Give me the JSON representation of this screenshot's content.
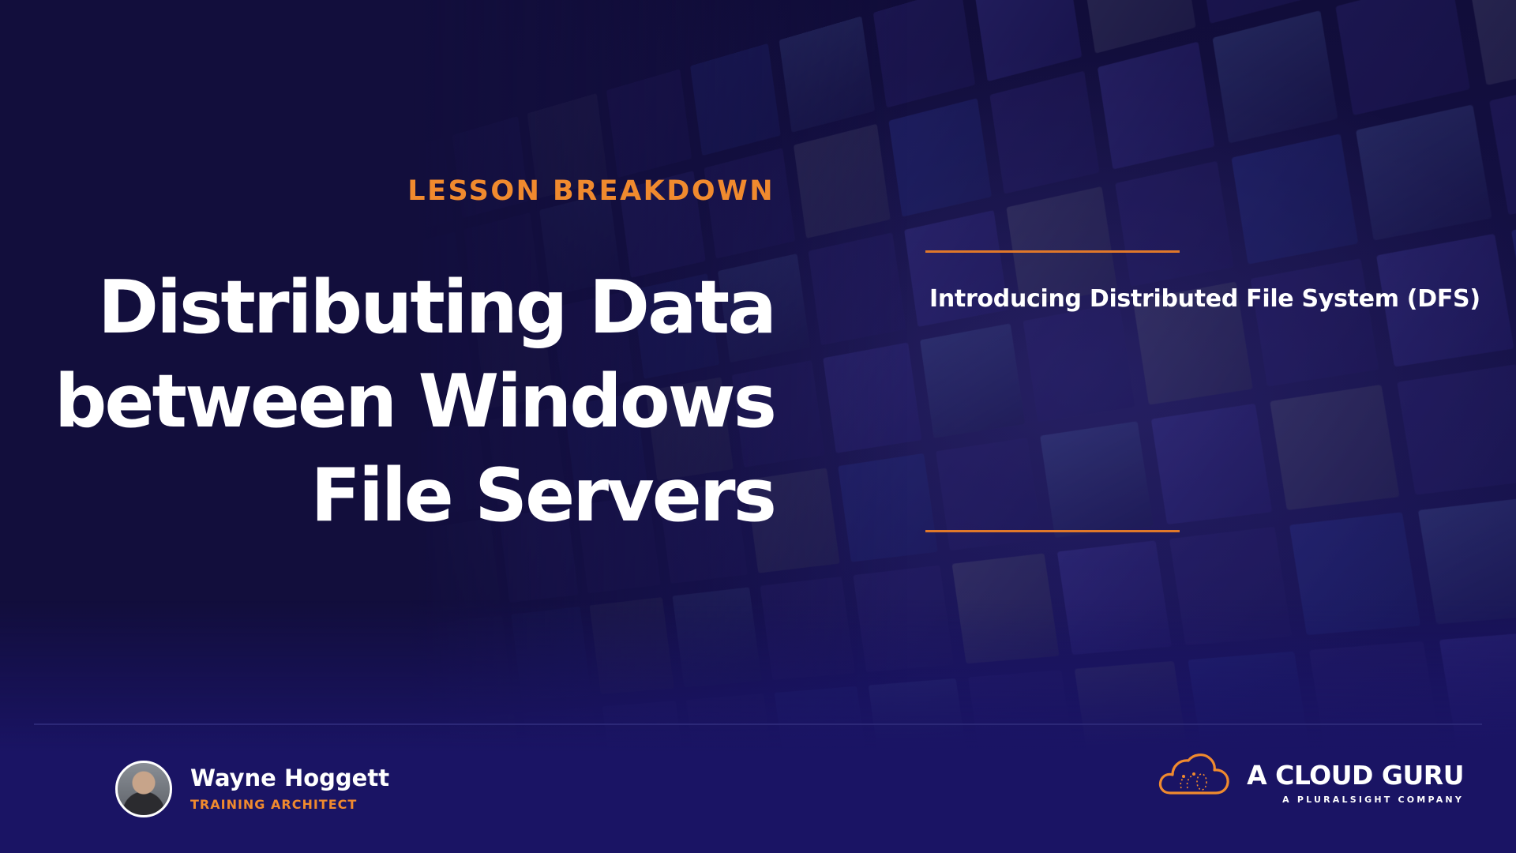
{
  "lesson": {
    "eyebrow": "LESSON BREAKDOWN",
    "title_lines": [
      "Distributing Data",
      "between Windows",
      "File Servers"
    ],
    "topic": "Introducing Distributed File System (DFS)"
  },
  "presenter": {
    "name": "Wayne Hoggett",
    "role": "TRAINING ARCHITECT"
  },
  "brand": {
    "name": "A CLOUD GURU",
    "tagline": "A PLURALSIGHT COMPANY",
    "logo_icon": "cloud-icon"
  },
  "colors": {
    "background": "#130f3d",
    "accent": "#f08a2e",
    "text": "#ffffff",
    "divider": "#2c2877"
  }
}
